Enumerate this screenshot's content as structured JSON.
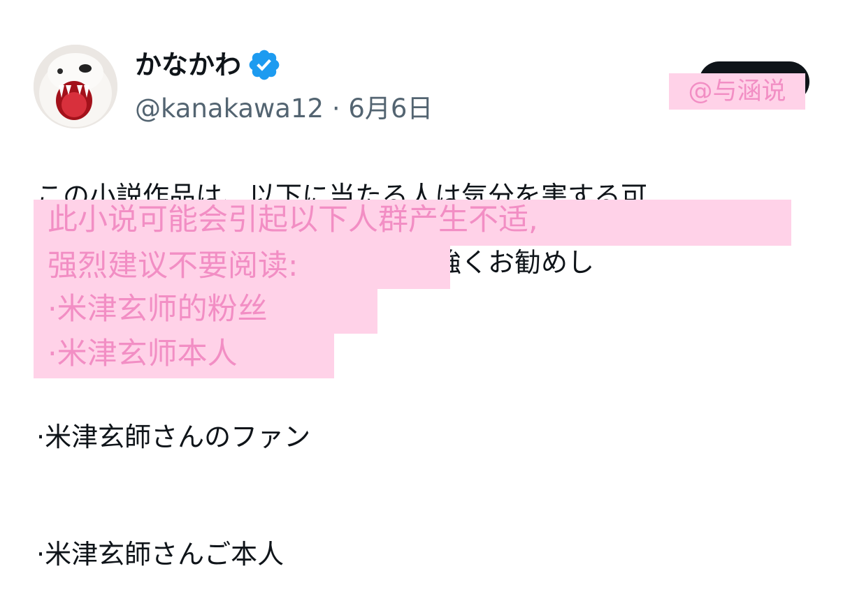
{
  "author": {
    "display_name": "かなかわ",
    "handle": "@kanakawa12",
    "date": "6月6日",
    "separator": "·",
    "verified_icon": "verified-badge-icon",
    "accent_color": "#1d9bf0"
  },
  "follow_button": {
    "label": "",
    "color": "#0f1419"
  },
  "watermark": {
    "text": "@与涵说",
    "background": "#ffd2e8",
    "color": "#f28ec4"
  },
  "tweet": {
    "line1": "この小説作品は、以下に当たる人は気分を害する可",
    "line2": "能性があるため、読まないことを強くお勧めし",
    "bullet1": "·米津玄師さんのファン",
    "bullet2": "·米津玄師さんご本人"
  },
  "overlay_translation": {
    "line1": "此小说可能会引起以下人群产生不适,",
    "line2": "强烈建议不要阅读:",
    "line3": "·米津玄师的粉丝",
    "line4": "·米津玄师本人",
    "background": "#ffd2e8",
    "color": "#f28ec4"
  }
}
